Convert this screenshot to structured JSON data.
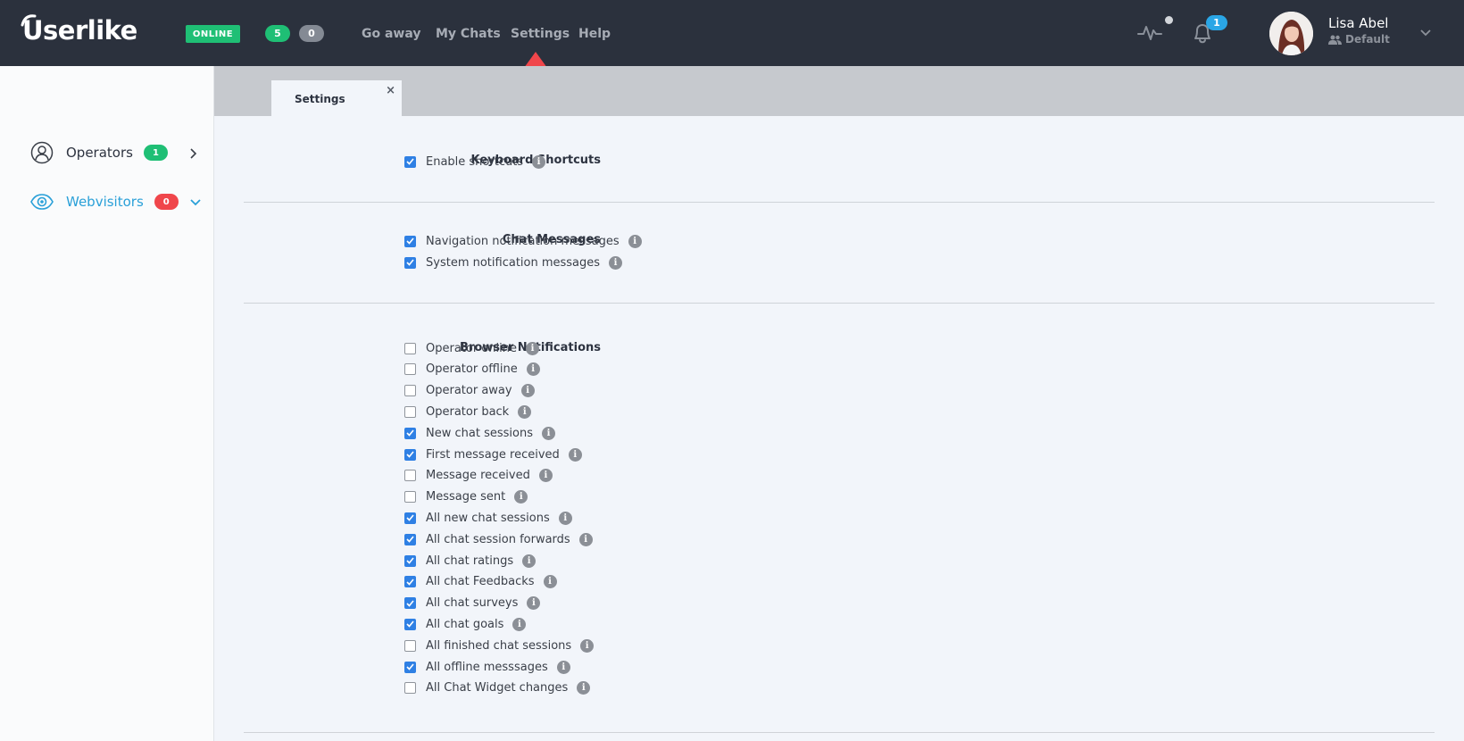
{
  "header": {
    "logo_text": "Userlike",
    "status": "ONLINE",
    "count_active": "5",
    "count_waiting": "0",
    "nav": [
      "Go away",
      "My Chats",
      "Settings",
      "Help"
    ],
    "notification_count": "1",
    "user_name": "Lisa Abel",
    "user_role": "Default",
    "colors": {
      "online": "#1fbf75",
      "notification": "#2aa6e6",
      "highlight_arrow": "#f0464b"
    }
  },
  "sidebar": {
    "items": [
      {
        "label": "Operators",
        "badge": "1",
        "badge_color": "#1fbf75",
        "text_color": "#2d3340"
      },
      {
        "label": "Webvisitors",
        "badge": "0",
        "badge_color": "#f0464b",
        "text_color": "#2aa0d8"
      }
    ]
  },
  "tab": {
    "label": "Settings",
    "close": "×"
  },
  "settings": {
    "keyboard": {
      "title": "Keyboard Shortcuts",
      "options": [
        {
          "label": "Enable shortcuts",
          "checked": true
        }
      ]
    },
    "chat_messages": {
      "title": "Chat Messages",
      "options": [
        {
          "label": "Navigation notification messages",
          "checked": true
        },
        {
          "label": "System notification messages",
          "checked": true
        }
      ]
    },
    "browser": {
      "title": "Browser Notifications",
      "options": [
        {
          "label": "Operator online",
          "checked": false
        },
        {
          "label": "Operator offline",
          "checked": false
        },
        {
          "label": "Operator away",
          "checked": false
        },
        {
          "label": "Operator back",
          "checked": false
        },
        {
          "label": "New chat sessions",
          "checked": true
        },
        {
          "label": "First message received",
          "checked": true
        },
        {
          "label": "Message received",
          "checked": false
        },
        {
          "label": "Message sent",
          "checked": false
        },
        {
          "label": "All new chat sessions",
          "checked": true
        },
        {
          "label": "All chat session forwards",
          "checked": true
        },
        {
          "label": "All chat ratings",
          "checked": true
        },
        {
          "label": "All chat Feedbacks",
          "checked": true
        },
        {
          "label": "All chat surveys",
          "checked": true
        },
        {
          "label": "All chat goals",
          "checked": true
        },
        {
          "label": "All finished chat sessions",
          "checked": false
        },
        {
          "label": "All offline messsages",
          "checked": true
        },
        {
          "label": "All Chat Widget changes",
          "checked": false
        }
      ]
    }
  }
}
